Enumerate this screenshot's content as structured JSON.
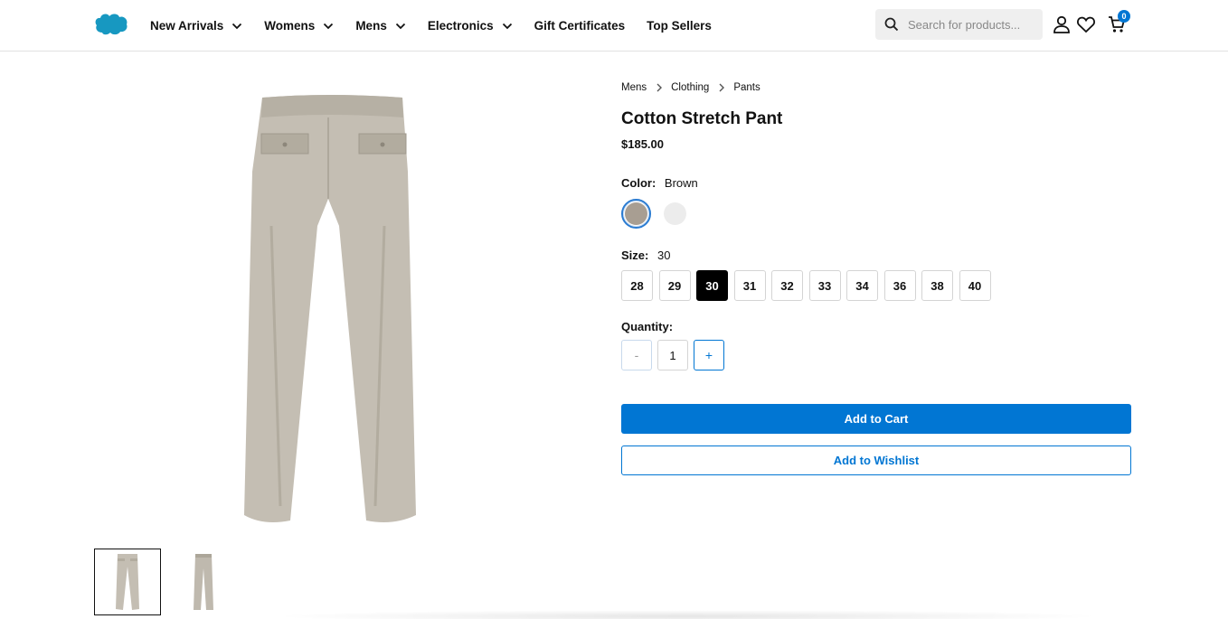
{
  "header": {
    "logo_icon": "salesforce-cloud-logo",
    "nav": [
      {
        "label": "New Arrivals",
        "has_dropdown": true
      },
      {
        "label": "Womens",
        "has_dropdown": true
      },
      {
        "label": "Mens",
        "has_dropdown": true
      },
      {
        "label": "Electronics",
        "has_dropdown": true
      },
      {
        "label": "Gift Certificates",
        "has_dropdown": false
      },
      {
        "label": "Top Sellers",
        "has_dropdown": false
      }
    ],
    "search": {
      "placeholder": "Search for products...",
      "icon": "search-icon"
    },
    "icons": [
      "account-icon",
      "wishlist-heart-icon",
      "cart-icon"
    ],
    "cart_count": "0",
    "accent_color": "#0176d3"
  },
  "breadcrumb": [
    "Mens",
    "Clothing",
    "Pants"
  ],
  "product": {
    "title": "Cotton Stretch Pant",
    "price": "$185.00",
    "color_label": "Color:",
    "color_value": "Brown",
    "swatches": [
      {
        "name": "Brown",
        "color": "#a89e92",
        "selected": true
      },
      {
        "name": "White",
        "color": "#ececec",
        "selected": false
      }
    ],
    "size_label": "Size:",
    "size_value": "30",
    "sizes": [
      "28",
      "29",
      "30",
      "31",
      "32",
      "33",
      "34",
      "36",
      "38",
      "40"
    ],
    "selected_size": "30",
    "quantity_label": "Quantity:",
    "quantity": "1",
    "minus_label": "-",
    "plus_label": "+",
    "add_to_cart": "Add to Cart",
    "add_to_wishlist": "Add to Wishlist",
    "pant_color": "#c4beb3"
  }
}
